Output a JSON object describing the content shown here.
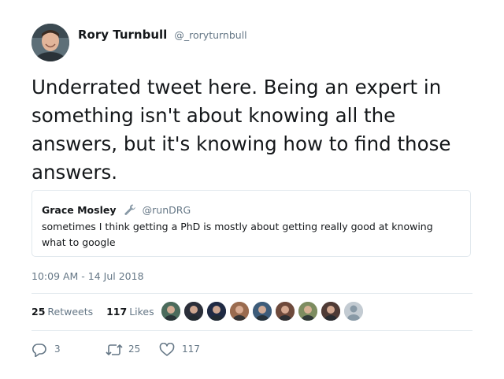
{
  "author": {
    "name": "Rory Turnbull",
    "handle": "@_roryturnbull",
    "avatar_icon": "profile-photo-icon"
  },
  "tweet": {
    "text": "Underrated tweet here. Being an expert in something isn't about knowing all the answers, but it's knowing how to find those answers.",
    "timestamp": "10:09 AM - 14 Jul 2018"
  },
  "quoted_tweet": {
    "name": "Grace Mosley",
    "name_emoji_icon": "wrench-icon",
    "handle": "@runDRG",
    "text": "sometimes I think getting a PhD is mostly about getting really good at knowing what to google"
  },
  "stats": {
    "retweets_count": "25",
    "retweets_label": "Retweets",
    "likes_count": "117",
    "likes_label": "Likes"
  },
  "likers": [
    {
      "icon": "liker-avatar-icon",
      "color": "#4b6b5c"
    },
    {
      "icon": "liker-avatar-icon",
      "color": "#2b2f3a"
    },
    {
      "icon": "liker-avatar-icon",
      "color": "#1f2a44"
    },
    {
      "icon": "liker-avatar-icon",
      "color": "#9a6b4f"
    },
    {
      "icon": "liker-avatar-icon",
      "color": "#3d5c7a"
    },
    {
      "icon": "liker-avatar-icon",
      "color": "#6e4a3c"
    },
    {
      "icon": "liker-avatar-icon",
      "color": "#7d8c60"
    },
    {
      "icon": "liker-avatar-icon",
      "color": "#4f3b36"
    },
    {
      "icon": "default-avatar-icon",
      "color": "#c3cbd2"
    }
  ],
  "actions": {
    "reply_count": "3",
    "retweet_count": "25",
    "like_count": "117"
  },
  "colors": {
    "text": "#14171a",
    "secondary": "#657786",
    "border": "#e1e8ed"
  }
}
